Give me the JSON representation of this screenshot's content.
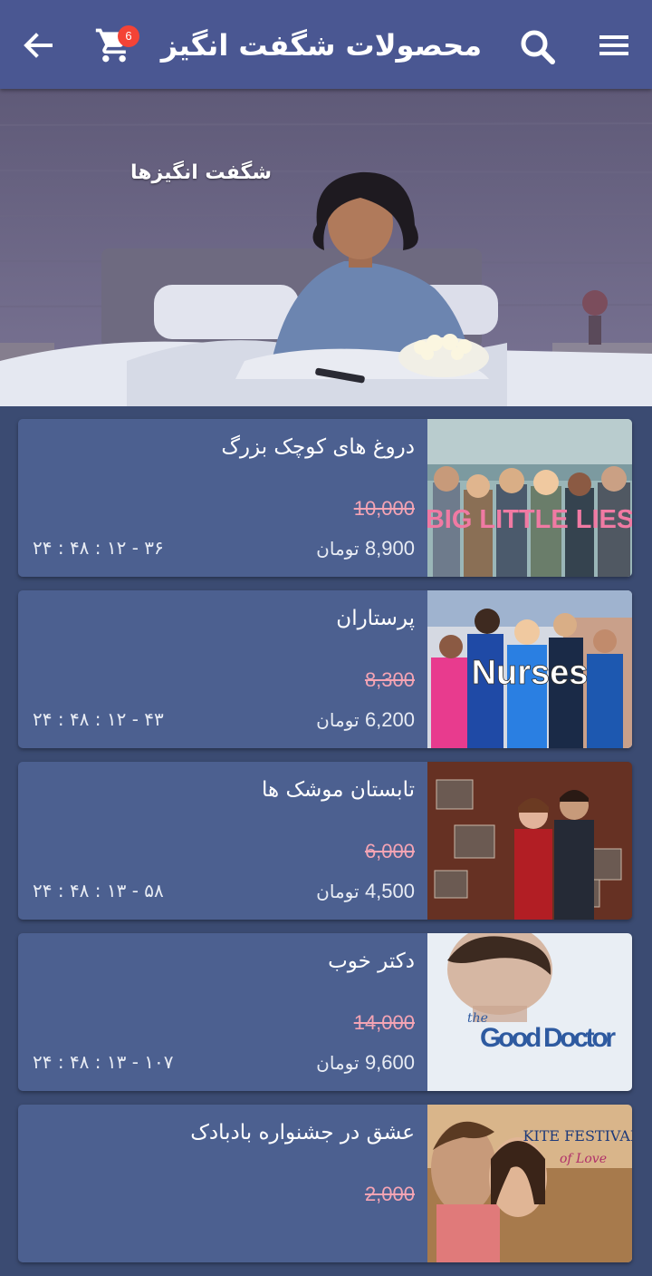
{
  "header": {
    "title": "محصولات شگفت انگیز",
    "cart_count": "6"
  },
  "banner": {
    "caption": "شگفت انگیزها"
  },
  "currency": "تومان",
  "products": [
    {
      "title": "دروغ های کوچک بزرگ",
      "old_price": "10,000",
      "price": "8,900",
      "countdown": "۲۴ : ۴۸ : ۱۲ - ۳۶",
      "poster_text": "BIG LITTLE LIES"
    },
    {
      "title": "پرستاران",
      "old_price": "8,300",
      "price": "6,200",
      "countdown": "۲۴ : ۴۸ : ۱۲ - ۴۳",
      "poster_text": "Nurses"
    },
    {
      "title": "تابستان موشک ها",
      "old_price": "6,000",
      "price": "4,500",
      "countdown": "۲۴ : ۴۸ : ۱۳ - ۵۸",
      "poster_text": ""
    },
    {
      "title": "دکتر خوب",
      "old_price": "14,000",
      "price": "9,600",
      "countdown": "۲۴ : ۴۸ : ۱۳ - ۱۰۷",
      "poster_text_small": "the",
      "poster_text": "Good Doctor"
    },
    {
      "title": "عشق در جشنواره بادبادک",
      "old_price": "2,000",
      "price": "",
      "countdown": "",
      "poster_text": "KITE FESTIVAL",
      "poster_text_small": "of Love"
    }
  ],
  "colors": {
    "topbar": "#4a5792",
    "background": "#3b4b72",
    "card": "#4c6090",
    "old_price": "#f4a4b4",
    "badge": "#f44336"
  }
}
